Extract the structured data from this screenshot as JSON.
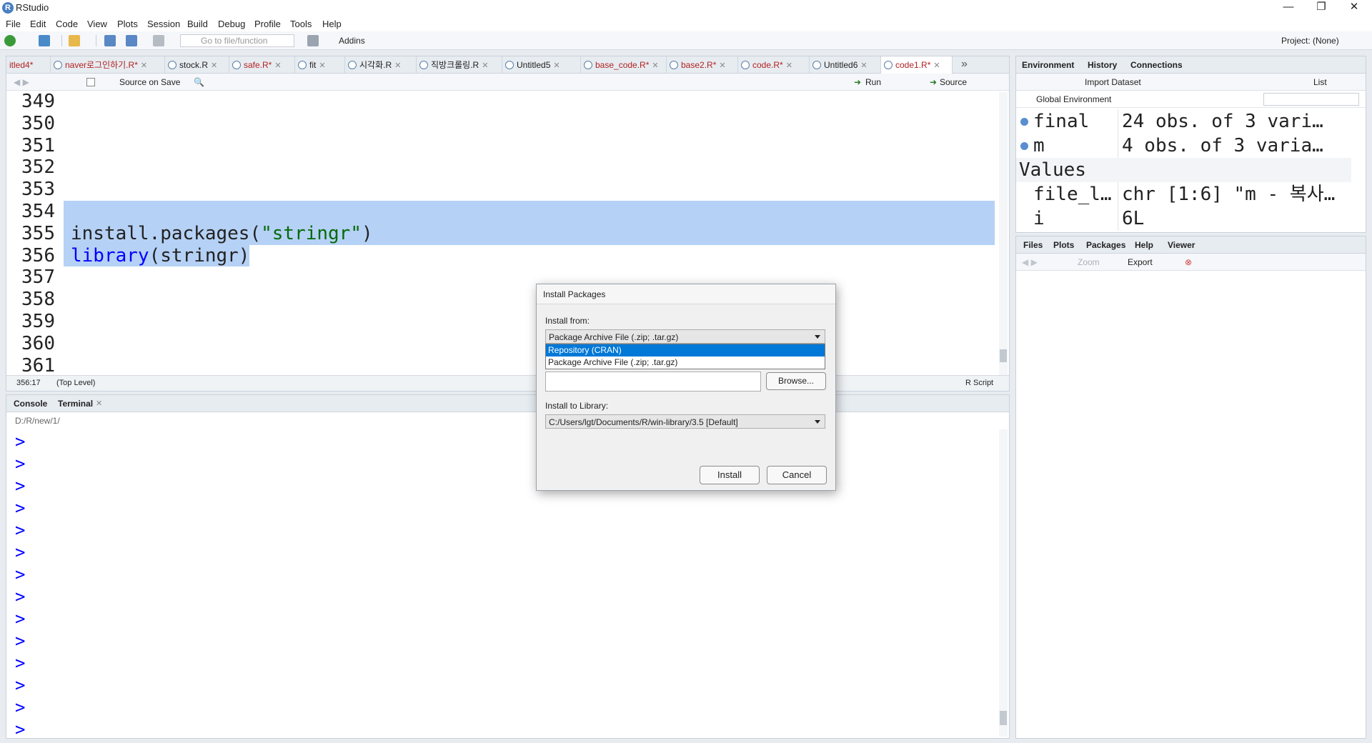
{
  "window": {
    "title": "RStudio",
    "logo": "R",
    "min_glyph": "—",
    "max_glyph": "❐",
    "close_glyph": "✕"
  },
  "menu": [
    "File",
    "Edit",
    "Code",
    "View",
    "Plots",
    "Session",
    "Build",
    "Debug",
    "Profile",
    "Tools",
    "Help"
  ],
  "toolbar": {
    "goto_placeholder": "Go to file/function",
    "addins_label": "Addins",
    "project_label": "Project: (None)"
  },
  "editor": {
    "tabs": [
      {
        "label": "itled4*",
        "modified": true
      },
      {
        "label": "naver로그인하기.R*",
        "modified": true
      },
      {
        "label": "stock.R",
        "modified": false
      },
      {
        "label": "safe.R*",
        "modified": true
      },
      {
        "label": "fit",
        "modified": false
      },
      {
        "label": "시각화.R",
        "modified": false
      },
      {
        "label": "직방크롤링.R",
        "modified": false
      },
      {
        "label": "Untitled5",
        "modified": false
      },
      {
        "label": "base_code.R*",
        "modified": true
      },
      {
        "label": "base2.R*",
        "modified": true
      },
      {
        "label": "code.R*",
        "modified": true
      },
      {
        "label": "Untitled6",
        "modified": false
      },
      {
        "label": "code1.R*",
        "modified": true
      }
    ],
    "source_on_save": "Source on Save",
    "run_label": "Run",
    "source_label": "Source",
    "line_numbers": [
      "349",
      "350",
      "351",
      "352",
      "353",
      "354",
      "355",
      "356",
      "357",
      "358",
      "359",
      "360",
      "361"
    ],
    "lines": {
      "l355_fn": "install.packages(",
      "l355_str": "\"stringr\"",
      "l355_close": ")",
      "l356_fn": "library",
      "l356_rest": "(stringr)"
    },
    "status": {
      "position": "356:17",
      "scope": "(Top Level)",
      "filetype": "R Script"
    }
  },
  "console": {
    "tabs": [
      "Console",
      "Terminal"
    ],
    "path": "D:/R/new/1/",
    "prompt_char": ">",
    "prompt_count": 14
  },
  "environment": {
    "tabs": [
      "Environment",
      "History",
      "Connections"
    ],
    "import_label": "Import Dataset",
    "list_label": "List",
    "scope_label": "Global Environment",
    "data_rows": [
      {
        "name": "final",
        "value": "24 obs. of 3 vari…"
      },
      {
        "name": "m",
        "value": "4 obs. of 3 varia…"
      }
    ],
    "values_header": "Values",
    "value_rows": [
      {
        "name": "file_l…",
        "value": "chr [1:6] \"m - 복사…"
      },
      {
        "name": "i",
        "value": "6L"
      }
    ]
  },
  "files": {
    "tabs": [
      "Files",
      "Plots",
      "Packages",
      "Help",
      "Viewer"
    ],
    "zoom_label": "Zoom",
    "export_label": "Export"
  },
  "dialog": {
    "title": "Install Packages",
    "install_from_label": "Install from:",
    "install_from_value": "Package Archive File (.zip; .tar.gz)",
    "options": [
      "Repository (CRAN)",
      "Package Archive File (.zip; .tar.gz)"
    ],
    "selected_option_index": 0,
    "browse_label": "Browse...",
    "library_label": "Install to Library:",
    "library_value": "C:/Users/lgt/Documents/R/win-library/3.5 [Default]",
    "install_label": "Install",
    "cancel_label": "Cancel"
  },
  "colors": {
    "selection": "#b5d1f5",
    "string": "#036a07",
    "keyword": "#0000ff",
    "modified_tab": "#b22222",
    "dropdown_highlight": "#0078d7"
  }
}
